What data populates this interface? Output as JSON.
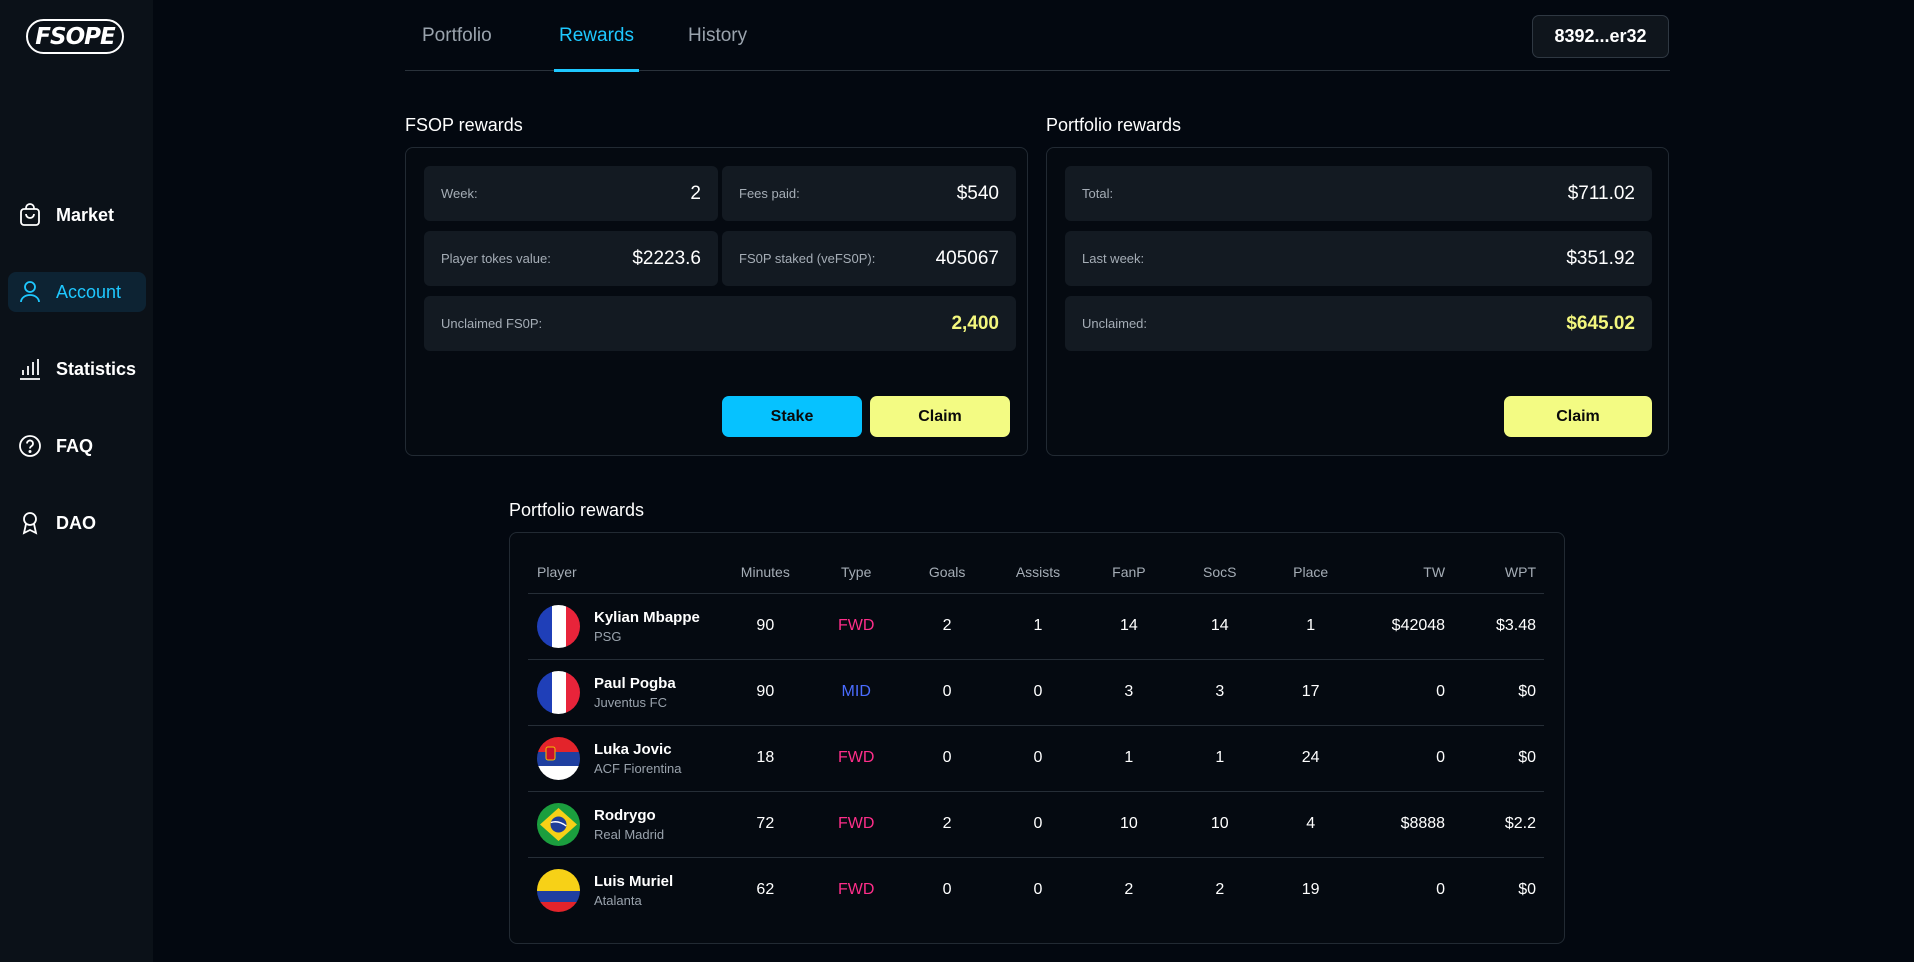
{
  "app": {
    "logo_text": "FSOPE"
  },
  "sidebar": {
    "items": [
      {
        "label": "Market",
        "icon": "shopping-bag-icon",
        "active": false
      },
      {
        "label": "Account",
        "icon": "user-icon",
        "active": true
      },
      {
        "label": "Statistics",
        "icon": "bar-chart-icon",
        "active": false
      },
      {
        "label": "FAQ",
        "icon": "question-circle-icon",
        "active": false
      },
      {
        "label": "DAO",
        "icon": "award-icon",
        "active": false
      }
    ]
  },
  "header": {
    "tabs": [
      {
        "label": "Portfolio",
        "active": false
      },
      {
        "label": "Rewards",
        "active": true
      },
      {
        "label": "History",
        "active": false
      }
    ],
    "wallet": "8392...er32"
  },
  "fsop_rewards": {
    "title": "FSOP rewards",
    "week_label": "Week:",
    "week_value": "2",
    "fees_label": "Fees paid:",
    "fees_value": "$540",
    "player_tokens_label": "Player tokes value:",
    "player_tokens_value": "$2223.6",
    "staked_label": "FS0P staked (veFS0P):",
    "staked_value": "405067",
    "unclaimed_label": "Unclaimed FS0P:",
    "unclaimed_value": "2,400",
    "stake_button": "Stake",
    "claim_button": "Claim"
  },
  "portfolio_rewards": {
    "title": "Portfolio rewards",
    "total_label": "Total:",
    "total_value": "$711.02",
    "last_week_label": "Last week:",
    "last_week_value": "$351.92",
    "unclaimed_label": "Unclaimed:",
    "unclaimed_value": "$645.02",
    "claim_button": "Claim"
  },
  "table": {
    "title": "Portfolio rewards",
    "columns": [
      "Player",
      "Minutes",
      "Type",
      "Goals",
      "Assists",
      "FanP",
      "SocS",
      "Place",
      "TW",
      "WPT"
    ],
    "rows": [
      {
        "name": "Kylian Mbappe",
        "club": "PSG",
        "flag": "france",
        "minutes": "90",
        "type": "FWD",
        "goals": "2",
        "assists": "1",
        "fanp": "14",
        "socs": "14",
        "place": "1",
        "tw": "$42048",
        "wpt": "$3.48"
      },
      {
        "name": "Paul Pogba",
        "club": "Juventus FC",
        "flag": "france",
        "minutes": "90",
        "type": "MID",
        "goals": "0",
        "assists": "0",
        "fanp": "3",
        "socs": "3",
        "place": "17",
        "tw": "0",
        "wpt": "$0"
      },
      {
        "name": "Luka Jovic",
        "club": "ACF Fiorentina",
        "flag": "serbia",
        "minutes": "18",
        "type": "FWD",
        "goals": "0",
        "assists": "0",
        "fanp": "1",
        "socs": "1",
        "place": "24",
        "tw": "0",
        "wpt": "$0"
      },
      {
        "name": "Rodrygo",
        "club": "Real Madrid",
        "flag": "brazil",
        "minutes": "72",
        "type": "FWD",
        "goals": "2",
        "assists": "0",
        "fanp": "10",
        "socs": "10",
        "place": "4",
        "tw": "$8888",
        "wpt": "$2.2"
      },
      {
        "name": "Luis Muriel",
        "club": "Atalanta",
        "flag": "colombia",
        "minutes": "62",
        "type": "FWD",
        "goals": "0",
        "assists": "0",
        "fanp": "2",
        "socs": "2",
        "place": "19",
        "tw": "0",
        "wpt": "$0"
      }
    ]
  },
  "colors": {
    "accent": "#1ec8ff",
    "highlight": "#f3f77e",
    "fwd": "#ff2e8a",
    "mid": "#4a6cff",
    "background": "#030810"
  }
}
